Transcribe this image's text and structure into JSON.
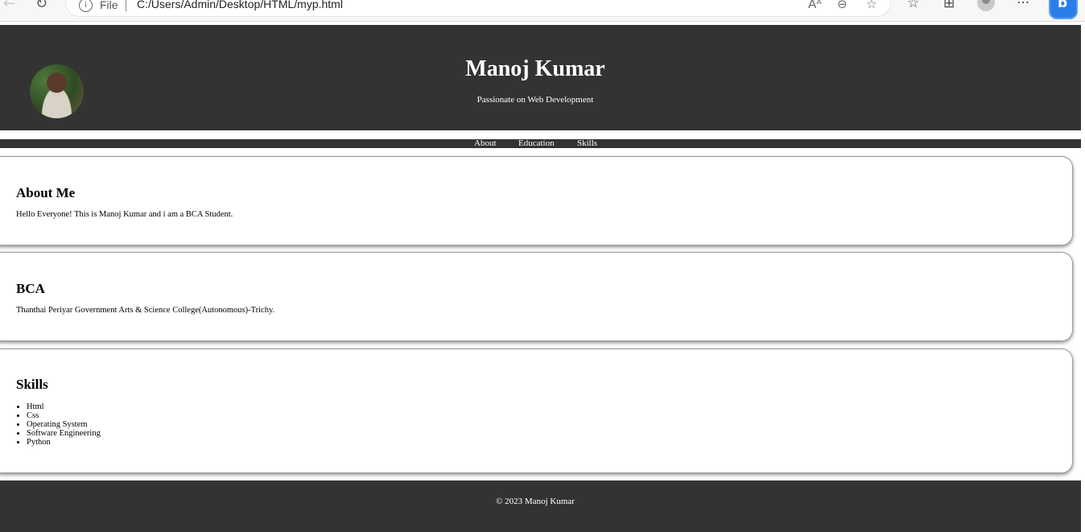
{
  "browser": {
    "file_label": "File",
    "url": "C:/Users/Admin/Desktop/HTML/myp.html",
    "icons": [
      "back-icon",
      "reload-icon",
      "info-icon",
      "read-aloud-icon",
      "zoom-out-icon",
      "favorite-add-icon",
      "favorites-icon",
      "collections-icon",
      "profile-icon",
      "more-icon",
      "bing-icon"
    ]
  },
  "header": {
    "title": "Manoj Kumar",
    "tagline": "Passionate on Web Development"
  },
  "nav": {
    "items": [
      "About",
      "Education",
      "Skills"
    ]
  },
  "sections": {
    "about": {
      "heading": "About Me",
      "text": "Hello Everyone! This is Manoj Kumar and i am a BCA Student."
    },
    "education": {
      "heading": "BCA",
      "text": "Thanthai Periyar Government Arts & Science College(Autonomous)-Trichy."
    },
    "skills": {
      "heading": "Skills",
      "items": [
        "Html",
        "Css",
        "Operating System",
        "Software Engineering",
        "Python"
      ]
    }
  },
  "footer": {
    "text": "© 2023 Manoj Kumar"
  },
  "colors": {
    "dark_bar": "#333333",
    "text_light": "#ffffff",
    "card_bg": "#ffffff"
  }
}
